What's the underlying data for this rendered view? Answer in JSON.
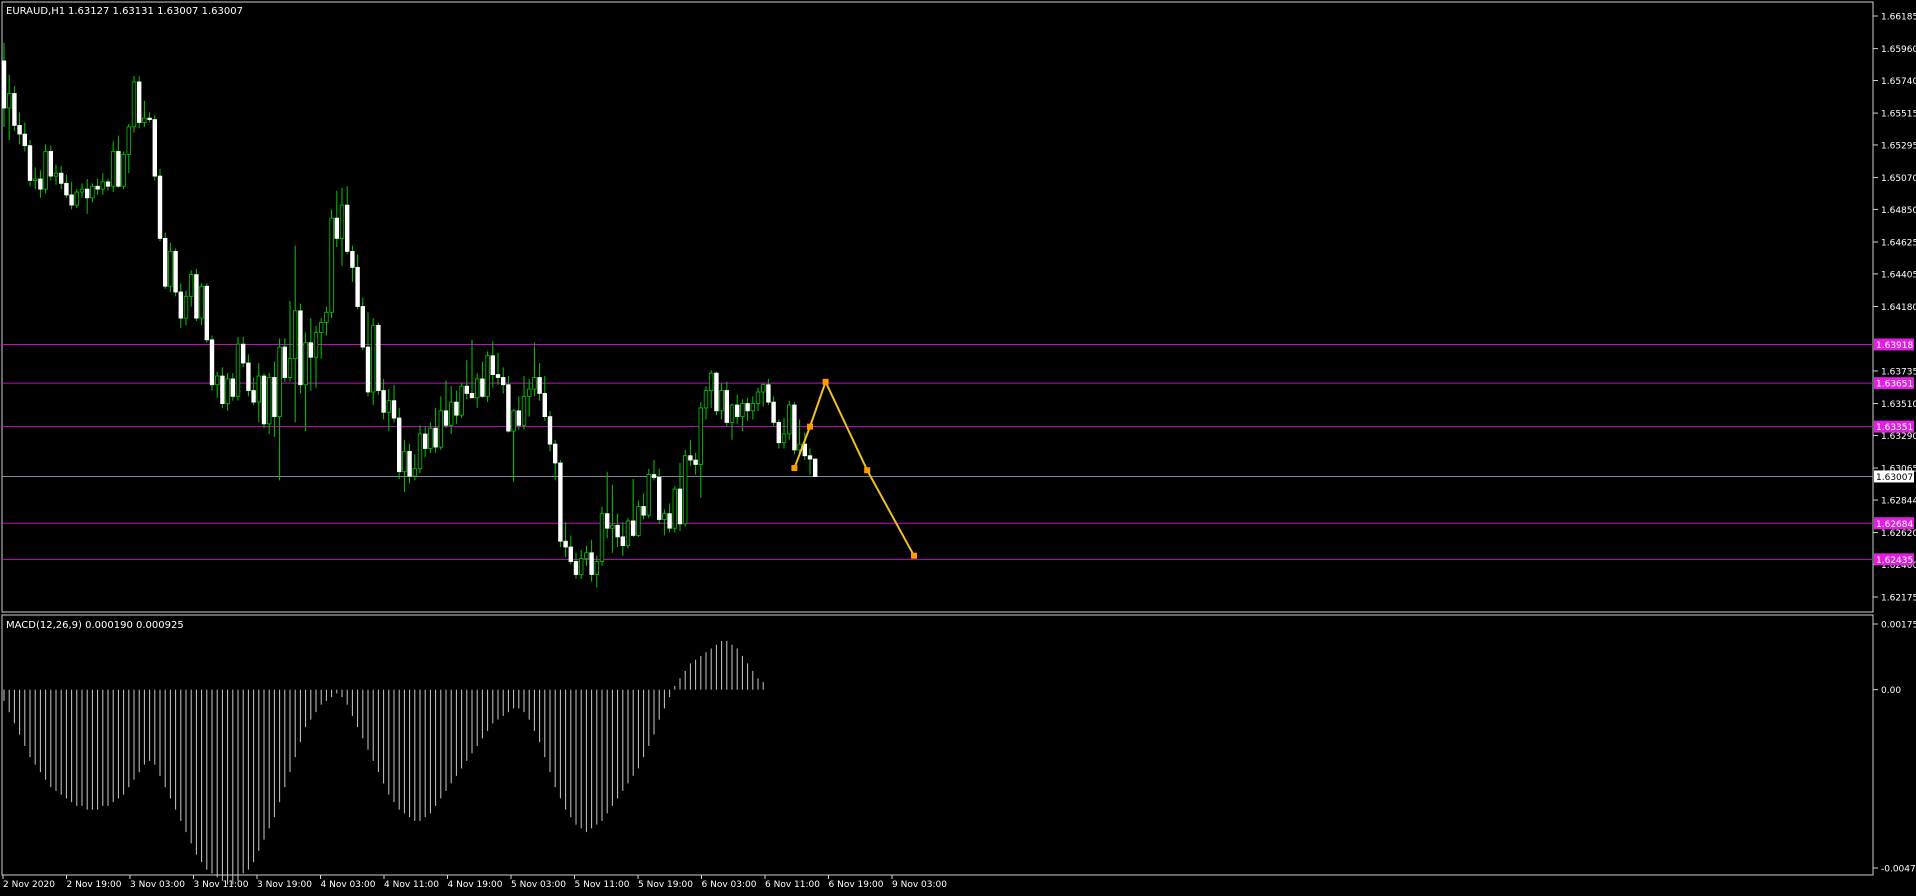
{
  "chart_data": [
    {
      "type": "candlestick",
      "symbol_info": "EURAUD,H1",
      "ohlc_info": "1.63127 1.63131 1.63007 1.63007",
      "y_ticks": [
        "1.66185",
        "1.65960",
        "1.65740",
        "1.65515",
        "1.65295",
        "1.65070",
        "1.64850",
        "1.64625",
        "1.64405",
        "1.64180",
        "1.63735",
        "1.63510",
        "1.63290",
        "1.63065",
        "1.62844",
        "1.62620",
        "1.62400",
        "1.62175"
      ],
      "ylim": [
        1.62175,
        1.66185
      ],
      "x_ticks": [
        "2 Nov 2020",
        "2 Nov 19:00",
        "3 Nov 03:00",
        "3 Nov 11:00",
        "3 Nov 19:00",
        "4 Nov 03:00",
        "4 Nov 11:00",
        "4 Nov 19:00",
        "5 Nov 03:00",
        "5 Nov 11:00",
        "5 Nov 19:00",
        "6 Nov 03:00",
        "6 Nov 11:00",
        "6 Nov 19:00",
        "9 Nov 03:00"
      ],
      "current_price": "1.63007",
      "horizontal_levels": [
        {
          "label": "1.63918",
          "value": 1.63918
        },
        {
          "label": "1.63651",
          "value": 1.63651
        },
        {
          "label": "1.63351",
          "value": 1.63351
        },
        {
          "label": "1.62684",
          "value": 1.62684
        },
        {
          "label": "1.62435",
          "value": 1.62435
        }
      ],
      "projection_path": [
        {
          "bar": 152,
          "price": 1.63065
        },
        {
          "bar": 155,
          "price": 1.63351
        },
        {
          "bar": 158,
          "price": 1.6366
        },
        {
          "bar": 166,
          "price": 1.6305
        },
        {
          "bar": 175,
          "price": 1.6246
        }
      ],
      "candles": [
        [
          1.65875,
          1.66,
          1.6542,
          1.6555
        ],
        [
          1.6555,
          1.6578,
          1.6533,
          1.6565
        ],
        [
          1.6565,
          1.657,
          1.6539,
          1.6543
        ],
        [
          1.6543,
          1.6552,
          1.653,
          1.6537
        ],
        [
          1.6537,
          1.6545,
          1.6525,
          1.6529
        ],
        [
          1.6529,
          1.6533,
          1.6501,
          1.6505
        ],
        [
          1.6505,
          1.6514,
          1.6499,
          1.6506
        ],
        [
          1.6506,
          1.6512,
          1.6493,
          1.6499
        ],
        [
          1.6499,
          1.653,
          1.6496,
          1.6525
        ],
        [
          1.6525,
          1.6529,
          1.6505,
          1.6508
        ],
        [
          1.6508,
          1.6516,
          1.6502,
          1.651
        ],
        [
          1.651,
          1.6515,
          1.6499,
          1.6503
        ],
        [
          1.6503,
          1.6509,
          1.6493,
          1.6495
        ],
        [
          1.6495,
          1.6504,
          1.6485,
          1.6488
        ],
        [
          1.6488,
          1.6499,
          1.6486,
          1.6497
        ],
        [
          1.6497,
          1.6503,
          1.6493,
          1.6499
        ],
        [
          1.6499,
          1.6506,
          1.6482,
          1.6493
        ],
        [
          1.6493,
          1.6503,
          1.649,
          1.6501
        ],
        [
          1.6501,
          1.6506,
          1.6495,
          1.6499
        ],
        [
          1.6499,
          1.651,
          1.6495,
          1.6504
        ],
        [
          1.6504,
          1.6506,
          1.6498,
          1.6501
        ],
        [
          1.6501,
          1.6532,
          1.6497,
          1.6525
        ],
        [
          1.6525,
          1.6536,
          1.65,
          1.6501
        ],
        [
          1.6501,
          1.6525,
          1.6499,
          1.6523
        ],
        [
          1.6523,
          1.6544,
          1.651,
          1.6542
        ],
        [
          1.6542,
          1.6577,
          1.6538,
          1.6573
        ],
        [
          1.6573,
          1.6577,
          1.6541,
          1.6545
        ],
        [
          1.6545,
          1.656,
          1.6542,
          1.6548
        ],
        [
          1.6548,
          1.6552,
          1.6545,
          1.6547
        ],
        [
          1.6547,
          1.655,
          1.6505,
          1.6508
        ],
        [
          1.6508,
          1.6513,
          1.6463,
          1.6465
        ],
        [
          1.6465,
          1.6469,
          1.643,
          1.6432
        ],
        [
          1.6432,
          1.6462,
          1.6428,
          1.6456
        ],
        [
          1.6456,
          1.6458,
          1.6425,
          1.6428
        ],
        [
          1.6428,
          1.6434,
          1.6403,
          1.641
        ],
        [
          1.641,
          1.6429,
          1.6405,
          1.6425
        ],
        [
          1.6425,
          1.6443,
          1.6418,
          1.644
        ],
        [
          1.644,
          1.6444,
          1.6408,
          1.641
        ],
        [
          1.641,
          1.6434,
          1.6405,
          1.6432
        ],
        [
          1.6432,
          1.6434,
          1.6393,
          1.6395
        ],
        [
          1.6395,
          1.6398,
          1.636,
          1.6364
        ],
        [
          1.6364,
          1.6373,
          1.6355,
          1.637
        ],
        [
          1.637,
          1.6376,
          1.6348,
          1.6351
        ],
        [
          1.6351,
          1.6372,
          1.6346,
          1.6368
        ],
        [
          1.6368,
          1.6372,
          1.6353,
          1.6356
        ],
        [
          1.6356,
          1.6397,
          1.6353,
          1.6392
        ],
        [
          1.6392,
          1.6397,
          1.6376,
          1.6379
        ],
        [
          1.6379,
          1.6385,
          1.6356,
          1.636
        ],
        [
          1.636,
          1.6369,
          1.635,
          1.6352
        ],
        [
          1.6352,
          1.6379,
          1.6338,
          1.637
        ],
        [
          1.637,
          1.6372,
          1.6334,
          1.6337
        ],
        [
          1.6337,
          1.6372,
          1.633,
          1.6369
        ],
        [
          1.6369,
          1.638,
          1.6328,
          1.6342
        ],
        [
          1.6342,
          1.6396,
          1.6298,
          1.639
        ],
        [
          1.639,
          1.6396,
          1.6366,
          1.6369
        ],
        [
          1.6369,
          1.6422,
          1.6366,
          1.6382
        ],
        [
          1.6382,
          1.646,
          1.6338,
          1.6415
        ],
        [
          1.6415,
          1.642,
          1.6358,
          1.6364
        ],
        [
          1.6364,
          1.64,
          1.6332,
          1.6393
        ],
        [
          1.6393,
          1.641,
          1.636,
          1.6383
        ],
        [
          1.6383,
          1.6405,
          1.6362,
          1.64
        ],
        [
          1.64,
          1.641,
          1.6382,
          1.6407
        ],
        [
          1.6407,
          1.6418,
          1.6398,
          1.6414
        ],
        [
          1.6414,
          1.6485,
          1.641,
          1.6479
        ],
        [
          1.6479,
          1.6498,
          1.6459,
          1.6465
        ],
        [
          1.6465,
          1.65,
          1.6446,
          1.6488
        ],
        [
          1.6488,
          1.6501,
          1.6454,
          1.6456
        ],
        [
          1.6456,
          1.646,
          1.6435,
          1.6445
        ],
        [
          1.6445,
          1.6454,
          1.6416,
          1.6418
        ],
        [
          1.6418,
          1.6424,
          1.6388,
          1.639
        ],
        [
          1.639,
          1.6414,
          1.6356,
          1.6359
        ],
        [
          1.6359,
          1.641,
          1.635,
          1.6405
        ],
        [
          1.6405,
          1.6407,
          1.6357,
          1.636
        ],
        [
          1.636,
          1.6368,
          1.634,
          1.6345
        ],
        [
          1.6345,
          1.6361,
          1.6332,
          1.6353
        ],
        [
          1.6353,
          1.6364,
          1.6338,
          1.6341
        ],
        [
          1.6341,
          1.6348,
          1.6299,
          1.6304
        ],
        [
          1.6304,
          1.6326,
          1.629,
          1.6318
        ],
        [
          1.6318,
          1.6323,
          1.6296,
          1.6301
        ],
        [
          1.6301,
          1.6316,
          1.6298,
          1.6306
        ],
        [
          1.6306,
          1.6336,
          1.6303,
          1.633
        ],
        [
          1.633,
          1.6335,
          1.6314,
          1.632
        ],
        [
          1.632,
          1.6338,
          1.6317,
          1.6334
        ],
        [
          1.6334,
          1.6348,
          1.6317,
          1.6321
        ],
        [
          1.6321,
          1.6356,
          1.6319,
          1.6346
        ],
        [
          1.6346,
          1.6367,
          1.6334,
          1.6336
        ],
        [
          1.6336,
          1.6363,
          1.633,
          1.6352
        ],
        [
          1.6352,
          1.636,
          1.6337,
          1.6343
        ],
        [
          1.6343,
          1.6365,
          1.6341,
          1.6363
        ],
        [
          1.6363,
          1.6381,
          1.6354,
          1.6358
        ],
        [
          1.6358,
          1.6395,
          1.6356,
          1.6355
        ],
        [
          1.6355,
          1.6372,
          1.6348,
          1.6368
        ],
        [
          1.6368,
          1.638,
          1.6355,
          1.6356
        ],
        [
          1.6356,
          1.6387,
          1.6352,
          1.6384
        ],
        [
          1.6384,
          1.6394,
          1.6362,
          1.6371
        ],
        [
          1.6371,
          1.6386,
          1.6364,
          1.6369
        ],
        [
          1.6369,
          1.6376,
          1.6358,
          1.6364
        ],
        [
          1.6364,
          1.637,
          1.6331,
          1.6332
        ],
        [
          1.6332,
          1.6347,
          1.6297,
          1.6346
        ],
        [
          1.6346,
          1.6356,
          1.6333,
          1.6336
        ],
        [
          1.6336,
          1.637,
          1.6333,
          1.6356
        ],
        [
          1.6356,
          1.6368,
          1.6342,
          1.6361
        ],
        [
          1.6361,
          1.6393,
          1.6356,
          1.6369
        ],
        [
          1.6369,
          1.6379,
          1.6353,
          1.6358
        ],
        [
          1.6358,
          1.637,
          1.6339,
          1.6342
        ],
        [
          1.6342,
          1.6346,
          1.6318,
          1.6323
        ],
        [
          1.6323,
          1.6326,
          1.6298,
          1.631
        ],
        [
          1.631,
          1.6312,
          1.6252,
          1.6256
        ],
        [
          1.6256,
          1.6269,
          1.6245,
          1.6252
        ],
        [
          1.6252,
          1.626,
          1.624,
          1.6242
        ],
        [
          1.6242,
          1.6248,
          1.623,
          1.6233
        ],
        [
          1.6233,
          1.625,
          1.623,
          1.6244
        ],
        [
          1.6244,
          1.6253,
          1.6239,
          1.6248
        ],
        [
          1.6248,
          1.6257,
          1.6228,
          1.6233
        ],
        [
          1.6233,
          1.6246,
          1.6224,
          1.6242
        ],
        [
          1.6242,
          1.628,
          1.6239,
          1.6275
        ],
        [
          1.6275,
          1.6304,
          1.6258,
          1.6265
        ],
        [
          1.6265,
          1.6295,
          1.6248,
          1.6267
        ],
        [
          1.6267,
          1.6275,
          1.6252,
          1.6259
        ],
        [
          1.6259,
          1.6269,
          1.6246,
          1.6253
        ],
        [
          1.6253,
          1.6272,
          1.6251,
          1.627
        ],
        [
          1.627,
          1.6299,
          1.6259,
          1.626
        ],
        [
          1.626,
          1.6284,
          1.6259,
          1.628
        ],
        [
          1.628,
          1.6289,
          1.6271,
          1.6274
        ],
        [
          1.6274,
          1.6306,
          1.6272,
          1.6302
        ],
        [
          1.6302,
          1.6312,
          1.6298,
          1.63
        ],
        [
          1.63,
          1.6306,
          1.6268,
          1.6271
        ],
        [
          1.6271,
          1.6278,
          1.626,
          1.6275
        ],
        [
          1.6275,
          1.6282,
          1.6262,
          1.6265
        ],
        [
          1.6265,
          1.6294,
          1.6262,
          1.6292
        ],
        [
          1.6292,
          1.631,
          1.6263,
          1.6268
        ],
        [
          1.6268,
          1.6319,
          1.6266,
          1.6315
        ],
        [
          1.6315,
          1.6326,
          1.6308,
          1.6312
        ],
        [
          1.6312,
          1.6317,
          1.6302,
          1.6309
        ],
        [
          1.6309,
          1.6352,
          1.6286,
          1.6348
        ],
        [
          1.6348,
          1.6363,
          1.634,
          1.636
        ],
        [
          1.636,
          1.6374,
          1.6348,
          1.6372
        ],
        [
          1.6372,
          1.6373,
          1.6343,
          1.6346
        ],
        [
          1.6346,
          1.6365,
          1.634,
          1.636
        ],
        [
          1.636,
          1.6366,
          1.6335,
          1.6338
        ],
        [
          1.6338,
          1.6351,
          1.6326,
          1.635
        ],
        [
          1.635,
          1.6357,
          1.6337,
          1.6342
        ],
        [
          1.6342,
          1.6354,
          1.6332,
          1.6351
        ],
        [
          1.6351,
          1.6355,
          1.6339,
          1.6346
        ],
        [
          1.6346,
          1.6356,
          1.634,
          1.6351
        ],
        [
          1.6351,
          1.6362,
          1.6346,
          1.6359
        ],
        [
          1.6359,
          1.6365,
          1.6349,
          1.6364
        ],
        [
          1.6364,
          1.6368,
          1.635,
          1.6352
        ],
        [
          1.6352,
          1.6356,
          1.6335,
          1.6338
        ],
        [
          1.6338,
          1.634,
          1.632,
          1.6324
        ],
        [
          1.6324,
          1.6341,
          1.632,
          1.633
        ],
        [
          1.633,
          1.6353,
          1.6326,
          1.635
        ],
        [
          1.635,
          1.6352,
          1.6316,
          1.6319
        ],
        [
          1.6319,
          1.634,
          1.6316,
          1.6323
        ],
        [
          1.6323,
          1.6331,
          1.6312,
          1.6315
        ],
        [
          1.6315,
          1.632,
          1.6302,
          1.63127
        ],
        [
          1.63127,
          1.63131,
          1.63007,
          1.63007
        ]
      ]
    },
    {
      "type": "histogram",
      "title": "MACD(12,26,9) 0.000190 0.000925",
      "y_ticks": [
        "0.001752",
        "0.00",
        "-0.004757"
      ],
      "ylim": [
        -0.004757,
        0.001752
      ],
      "values": [
        -0.0003,
        -0.0006,
        -0.0009,
        -0.0012,
        -0.0015,
        -0.0018,
        -0.002,
        -0.0022,
        -0.0024,
        -0.0026,
        -0.0027,
        -0.0028,
        -0.0029,
        -0.003,
        -0.0031,
        -0.0031,
        -0.0032,
        -0.0032,
        -0.0032,
        -0.0031,
        -0.0031,
        -0.003,
        -0.0029,
        -0.0028,
        -0.0026,
        -0.0024,
        -0.0022,
        -0.002,
        -0.0019,
        -0.002,
        -0.0023,
        -0.0026,
        -0.0029,
        -0.0032,
        -0.0035,
        -0.0038,
        -0.0041,
        -0.0044,
        -0.0046,
        -0.0048,
        -0.0049,
        -0.005,
        -0.0051,
        -0.0052,
        -0.0052,
        -0.0051,
        -0.0049,
        -0.0048,
        -0.0046,
        -0.0043,
        -0.004,
        -0.0037,
        -0.0034,
        -0.003,
        -0.0026,
        -0.0022,
        -0.0018,
        -0.0014,
        -0.001,
        -0.0008,
        -0.0006,
        -0.0004,
        -0.0003,
        -0.0002,
        -0.0001,
        -0.0002,
        -0.0004,
        -0.0007,
        -0.001,
        -0.0013,
        -0.0016,
        -0.0019,
        -0.0022,
        -0.0025,
        -0.0028,
        -0.003,
        -0.0032,
        -0.0033,
        -0.0034,
        -0.0035,
        -0.0035,
        -0.0034,
        -0.0033,
        -0.0031,
        -0.0029,
        -0.0027,
        -0.0025,
        -0.0023,
        -0.0021,
        -0.0019,
        -0.0017,
        -0.0015,
        -0.0013,
        -0.0011,
        -0.0009,
        -0.0008,
        -0.0007,
        -0.0006,
        -0.0005,
        -0.0005,
        -0.0006,
        -0.0008,
        -0.0011,
        -0.0014,
        -0.0018,
        -0.0022,
        -0.0026,
        -0.0029,
        -0.0032,
        -0.0034,
        -0.0036,
        -0.0037,
        -0.0038,
        -0.0037,
        -0.0036,
        -0.0035,
        -0.0033,
        -0.0031,
        -0.0029,
        -0.0027,
        -0.0025,
        -0.0023,
        -0.0021,
        -0.0018,
        -0.0015,
        -0.0012,
        -0.0008,
        -0.0005,
        -0.0002,
        0.0001,
        0.0003,
        0.0005,
        0.0007,
        0.0008,
        0.0009,
        0.001,
        0.0011,
        0.0012,
        0.0013,
        0.0013,
        0.0012,
        0.0011,
        0.0009,
        0.0007,
        0.0005,
        0.0003,
        0.0002
      ]
    }
  ]
}
